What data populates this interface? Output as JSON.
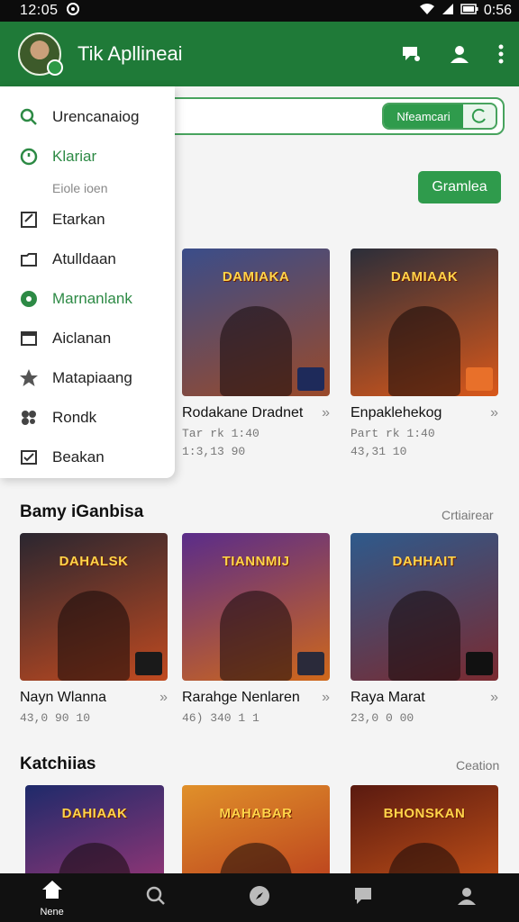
{
  "status_bar": {
    "time": "12:05",
    "battery": "0:56"
  },
  "app_bar": {
    "title": "Tik Apllineai"
  },
  "search": {
    "pill_label": "Nfeamcari"
  },
  "games_button": {
    "label": "Gramlea"
  },
  "drawer": {
    "items": [
      {
        "label": "Urencanaiog",
        "icon": "search-icon",
        "color": "#2d8a45"
      },
      {
        "label": "Klariar",
        "icon": "clock-icon",
        "color": "#2d8a45"
      },
      {
        "label": "Eiole ioen",
        "icon": "",
        "sub": true
      },
      {
        "label": "Etarkan",
        "icon": "edit-icon"
      },
      {
        "label": "Atulldaan",
        "icon": "folder-icon"
      },
      {
        "label": "Marnanlank",
        "icon": "circle-icon",
        "color": "#2d8a45"
      },
      {
        "label": "Aiclanan",
        "icon": "window-icon"
      },
      {
        "label": "Matapiaang",
        "icon": "star-icon"
      },
      {
        "label": "Rondk",
        "icon": "cluster-icon"
      },
      {
        "label": "Beakan",
        "icon": "check-box-icon"
      }
    ]
  },
  "row1": {
    "cards": [
      {
        "banner": "DAMIAKA",
        "title": "Rodakane Dradnet",
        "meta1": "Tar rk 1:40",
        "meta2": "1:3,13 90",
        "colors": [
          "#3a4d8a",
          "#9a4a2a"
        ]
      },
      {
        "banner": "DAMIAAK",
        "title": "Enpaklehekog",
        "meta1": "Part rk 1:40",
        "meta2": "43,31 10",
        "colors": [
          "#2b2e3a",
          "#d9581a"
        ]
      }
    ]
  },
  "section2": {
    "title": "Bamy iGanbisa",
    "link": "Crtiairear",
    "cards": [
      {
        "banner": "DAHALSK",
        "title": "Nayn Wlanna",
        "meta": "43,0 90 10",
        "colors": [
          "#2a2630",
          "#c04a20"
        ]
      },
      {
        "banner": "TIANNMIJ",
        "title": "Rarahge Nenlaren",
        "meta": "46) 340 1 1",
        "colors": [
          "#5a2c8a",
          "#d0681a"
        ]
      },
      {
        "banner": "DAHHAIT",
        "title": "Raya Marat",
        "meta": "23,0 0 00",
        "colors": [
          "#2e5a8c",
          "#7a2a30"
        ]
      }
    ]
  },
  "section3": {
    "title": "Katchiias",
    "link": "Ceation",
    "cards": [
      {
        "banner": "DAHIAAK",
        "colors": [
          "#1e2a6a",
          "#b83a7a"
        ]
      },
      {
        "banner": "MAHABAR",
        "colors": [
          "#e0902a",
          "#b02a1a"
        ]
      },
      {
        "banner": "BHONSKAN",
        "colors": [
          "#5a1a10",
          "#e0601a"
        ]
      }
    ]
  },
  "bottom_nav": {
    "items": [
      {
        "label": "Nene",
        "icon": "home-icon"
      },
      {
        "label": "",
        "icon": "search-icon"
      },
      {
        "label": "",
        "icon": "explore-icon"
      },
      {
        "label": "",
        "icon": "chat-icon"
      },
      {
        "label": "",
        "icon": "profile-icon"
      }
    ]
  },
  "colors": {
    "brand": "#1f7a38",
    "accent": "#2f9b4c"
  }
}
